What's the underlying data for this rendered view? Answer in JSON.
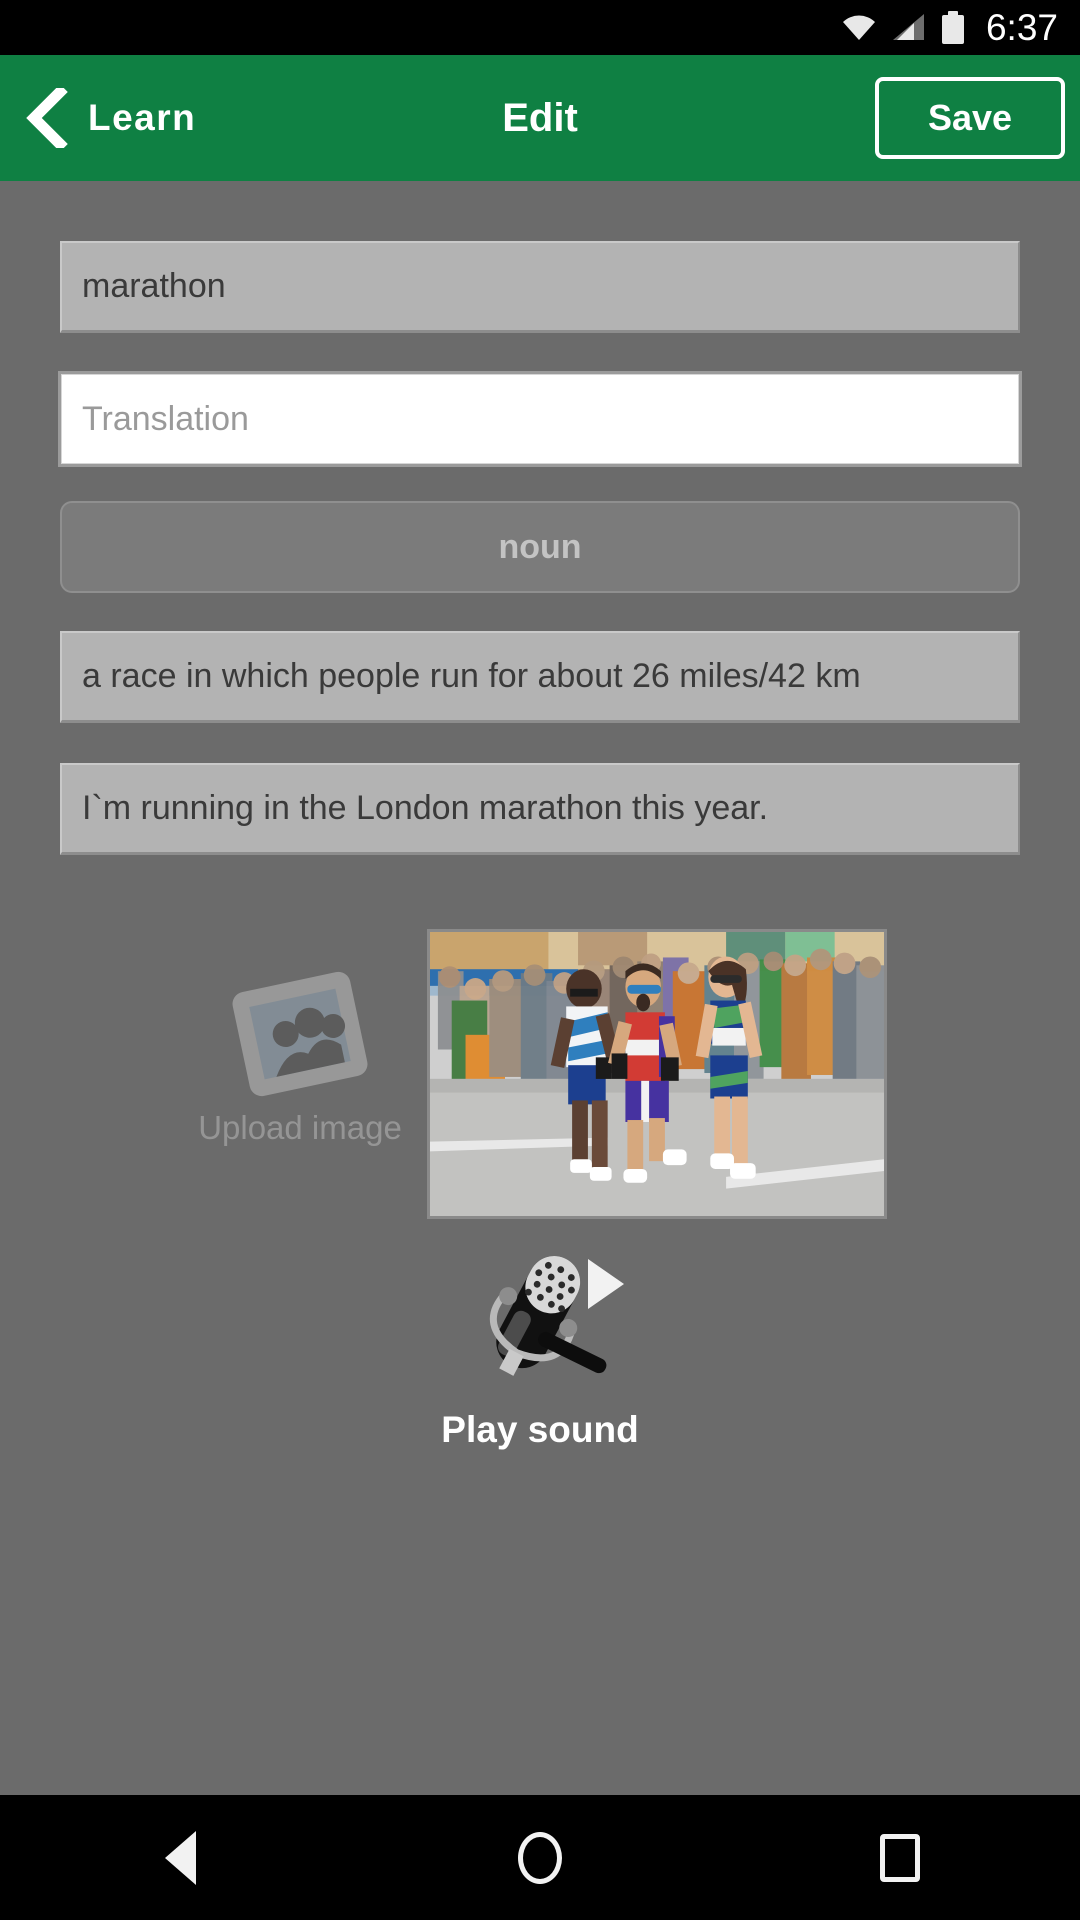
{
  "status_bar": {
    "time": "6:37",
    "icons": [
      "wifi-icon",
      "cellular-signal-icon",
      "battery-icon"
    ]
  },
  "app_bar": {
    "back_label": "Learn",
    "back_icon": "chevron-left-icon",
    "title": "Edit",
    "save_label": "Save",
    "background_color": "#0f8043"
  },
  "form": {
    "word_field": {
      "value": "marathon",
      "editable": true
    },
    "translation_field": {
      "value": "",
      "placeholder": "Translation",
      "focused": true
    },
    "part_of_speech_button": {
      "label": "noun"
    },
    "definition_field": {
      "value": "a race in which people run for about 26 miles/42 km"
    },
    "example_field": {
      "value": "I`m running in the London marathon this year."
    }
  },
  "media": {
    "upload": {
      "label": "Upload image",
      "icon": "image-placeholder-icon"
    },
    "thumbnail": {
      "alt": "three marathon runners racing on a street with a blurred crowd of spectators"
    }
  },
  "sound": {
    "label": "Play sound",
    "icon": "microphone-icon",
    "play_icon": "play-triangle-icon"
  },
  "nav_bar": {
    "items": [
      {
        "name": "back",
        "icon": "triangle-back-icon"
      },
      {
        "name": "home",
        "icon": "circle-home-icon"
      },
      {
        "name": "recents",
        "icon": "square-recents-icon"
      }
    ]
  },
  "colors": {
    "page_background": "#6b6b6b",
    "field_background": "#b3b3b3",
    "accent_green": "#0f8043",
    "text_dark": "#3a3a3a",
    "placeholder": "#9a9a9a"
  }
}
